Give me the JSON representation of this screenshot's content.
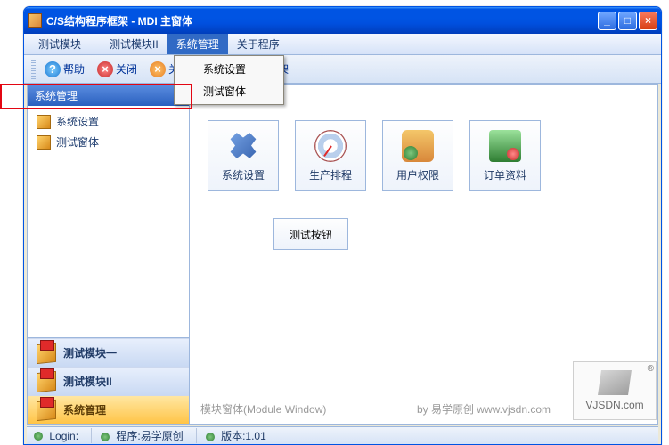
{
  "watermark": "www.vjsdn.com",
  "title": "C/S结构程序框架 - MDI 主窗体",
  "menubar": {
    "items": [
      "测试模块一",
      "测试模块II",
      "系统管理",
      "关于程序"
    ],
    "open_index": 2,
    "dropdown": [
      "系统设置",
      "测试窗体"
    ]
  },
  "toolbar": {
    "help": "帮助",
    "close": "关闭",
    "close2_prefix": "关",
    "suffix_text": "oolbar | 参考MDI框架"
  },
  "sidebar": {
    "header": "系统管理",
    "items": [
      "系统设置",
      "测试窗体"
    ],
    "nav": [
      "测试模块一",
      "测试模块II",
      "系统管理"
    ],
    "active_nav": 2
  },
  "content": {
    "tiles": [
      "系统设置",
      "生产排程",
      "用户权限",
      "订单资料"
    ],
    "test_button": "测试按钮",
    "footer_label": "模块窗体(Module Window)",
    "footer_credit": "by 易学原创 www.vjsdn.com"
  },
  "statusbar": {
    "login_label": "Login:",
    "program": "程序:易学原创",
    "version": "版本:1.01"
  },
  "logo": {
    "text": "VJSDN.com",
    "reg": "®"
  }
}
